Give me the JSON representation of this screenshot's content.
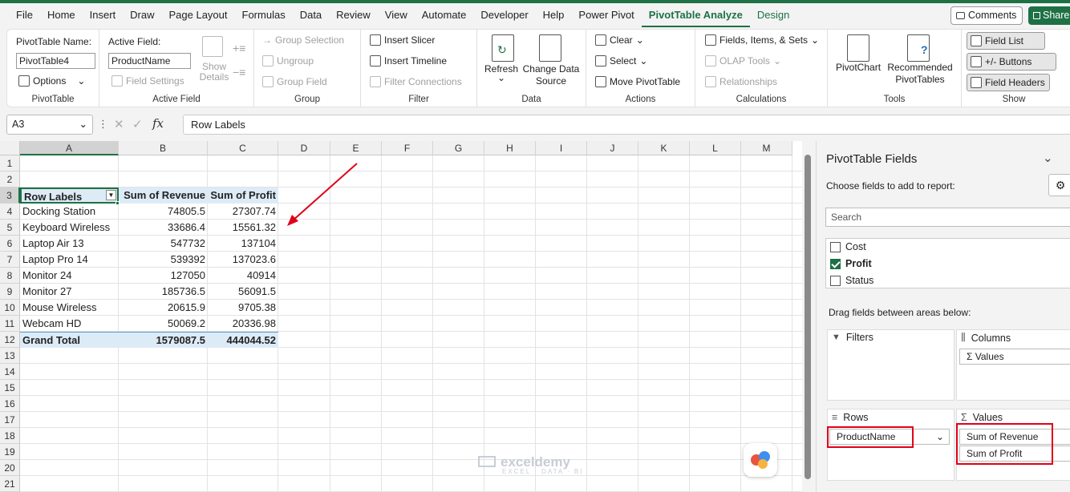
{
  "tabs": [
    "File",
    "Home",
    "Insert",
    "Draw",
    "Page Layout",
    "Formulas",
    "Data",
    "Review",
    "View",
    "Automate",
    "Developer",
    "Help",
    "Power Pivot",
    "PivotTable Analyze",
    "Design"
  ],
  "active_tab": "PivotTable Analyze",
  "comments_label": "Comments",
  "share_label": "Share",
  "ribbon": {
    "pivottable": {
      "name_label": "PivotTable Name:",
      "name_value": "PivotTable4",
      "options": "Options",
      "group": "PivotTable"
    },
    "active_field": {
      "label": "Active Field:",
      "value": "ProductName",
      "field_settings": "Field Settings",
      "show_details": "Show Details",
      "group": "Active Field"
    },
    "group": {
      "group_selection": "Group Selection",
      "ungroup": "Ungroup",
      "group_field": "Group Field",
      "group": "Group"
    },
    "filter": {
      "insert_slicer": "Insert Slicer",
      "insert_timeline": "Insert Timeline",
      "filter_connections": "Filter Connections",
      "group": "Filter"
    },
    "data": {
      "refresh": "Refresh",
      "change_source": "Change Data Source",
      "group": "Data"
    },
    "actions": {
      "clear": "Clear",
      "select": "Select",
      "move": "Move PivotTable",
      "group": "Actions"
    },
    "calculations": {
      "fields": "Fields, Items, & Sets",
      "olap": "OLAP Tools",
      "relationships": "Relationships",
      "group": "Calculations"
    },
    "tools": {
      "pivotchart": "PivotChart",
      "recommended": "Recommended PivotTables",
      "group": "Tools"
    },
    "show": {
      "field_list": "Field List",
      "buttons": "+/- Buttons",
      "field_headers": "Field Headers",
      "group": "Show"
    }
  },
  "formula_bar": {
    "cell_ref": "A3",
    "content": "Row Labels"
  },
  "columns": [
    "A",
    "B",
    "C",
    "D",
    "E",
    "F",
    "G",
    "H",
    "I",
    "J",
    "K",
    "L",
    "M"
  ],
  "rows": [
    "1",
    "2",
    "3",
    "4",
    "5",
    "6",
    "7",
    "8",
    "9",
    "10",
    "11",
    "12",
    "13",
    "14",
    "15",
    "16",
    "17",
    "18",
    "19",
    "20",
    "21"
  ],
  "pivot": {
    "headers": [
      "Row Labels",
      "Sum of Revenue",
      "Sum of Profit"
    ],
    "data": [
      [
        "Docking Station",
        "74805.5",
        "27307.74"
      ],
      [
        "Keyboard Wireless",
        "33686.4",
        "15561.32"
      ],
      [
        "Laptop Air 13",
        "547732",
        "137104"
      ],
      [
        "Laptop Pro 14",
        "539392",
        "137023.6"
      ],
      [
        "Monitor 24",
        "127050",
        "40914"
      ],
      [
        "Monitor 27",
        "185736.5",
        "56091.5"
      ],
      [
        "Mouse Wireless",
        "20615.9",
        "9705.38"
      ],
      [
        "Webcam HD",
        "50069.2",
        "20336.98"
      ]
    ],
    "total": [
      "Grand Total",
      "1579087.5",
      "444044.52"
    ]
  },
  "panel": {
    "title": "PivotTable Fields",
    "choose": "Choose fields to add to report:",
    "search_placeholder": "Search",
    "fields": [
      {
        "name": "Cost",
        "checked": false
      },
      {
        "name": "Profit",
        "checked": true
      },
      {
        "name": "Status",
        "checked": false
      }
    ],
    "drag": "Drag fields between areas below:",
    "filters": "Filters",
    "columns": "Columns",
    "columns_item": "Values",
    "rows": "Rows",
    "rows_item": "ProductName",
    "values": "Values",
    "values_items": [
      "Sum of Revenue",
      "Sum of Profit"
    ]
  },
  "watermark": {
    "name": "exceldemy",
    "tag": "EXCEL · DATA · BI"
  },
  "colors": {
    "accent": "#1e7145",
    "pivot_header": "#ddebf7",
    "red": "#e0001a"
  }
}
